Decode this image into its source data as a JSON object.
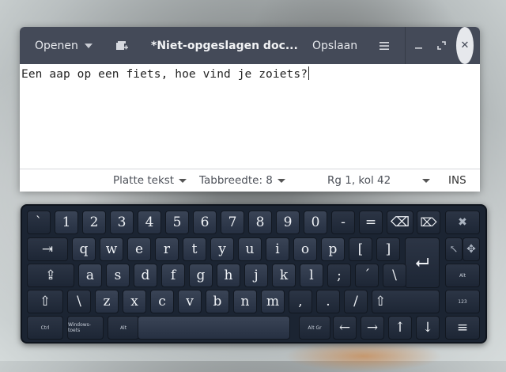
{
  "editor": {
    "open_label": "Openen",
    "title": "*Niet-opgeslagen doc...",
    "save_label": "Opslaan",
    "menu_icon": "hamburger-menu-icon",
    "minimize_icon": "minimize-icon",
    "maximize_icon": "maximize-icon",
    "close_glyph": "✕",
    "new_doc_icon": "new-document-icon",
    "content": "Een aap op een fiets, hoe vind je zoiets?",
    "status": {
      "language": "Platte tekst",
      "tab_width": "Tabbreedte: 8",
      "position": "Rg 1, kol 42",
      "mode": "INS"
    }
  },
  "keyboard": {
    "row1": [
      "`",
      "1",
      "2",
      "3",
      "4",
      "5",
      "6",
      "7",
      "8",
      "9",
      "0",
      "-",
      "="
    ],
    "row1_right": [
      "⌫",
      "⌦",
      "✖"
    ],
    "row2": [
      "⇥",
      "q",
      "w",
      "e",
      "r",
      "t",
      "y",
      "u",
      "i",
      "o",
      "p",
      "[",
      "]"
    ],
    "row2_right": [
      "⮠",
      "↖",
      "✥"
    ],
    "row3": [
      "⇪",
      "a",
      "s",
      "d",
      "f",
      "g",
      "h",
      "j",
      "k",
      "l",
      ";",
      "´",
      "\\"
    ],
    "row3_right": [
      "Alt"
    ],
    "row4": [
      "⇧",
      "\\",
      "z",
      "x",
      "c",
      "v",
      "b",
      "n",
      "m",
      ",",
      ".",
      "/",
      "⇧"
    ],
    "row4_right": [
      "123"
    ],
    "row5": [
      "Ctrl",
      "Windows-toets",
      "Alt",
      "",
      "Alt Gr",
      "←",
      "→",
      "↑",
      "↓",
      "≡"
    ]
  },
  "colors": {
    "header_bg": "#444a58",
    "keyboard_bg": "#1b2432",
    "key_bg": "#2f394b"
  }
}
